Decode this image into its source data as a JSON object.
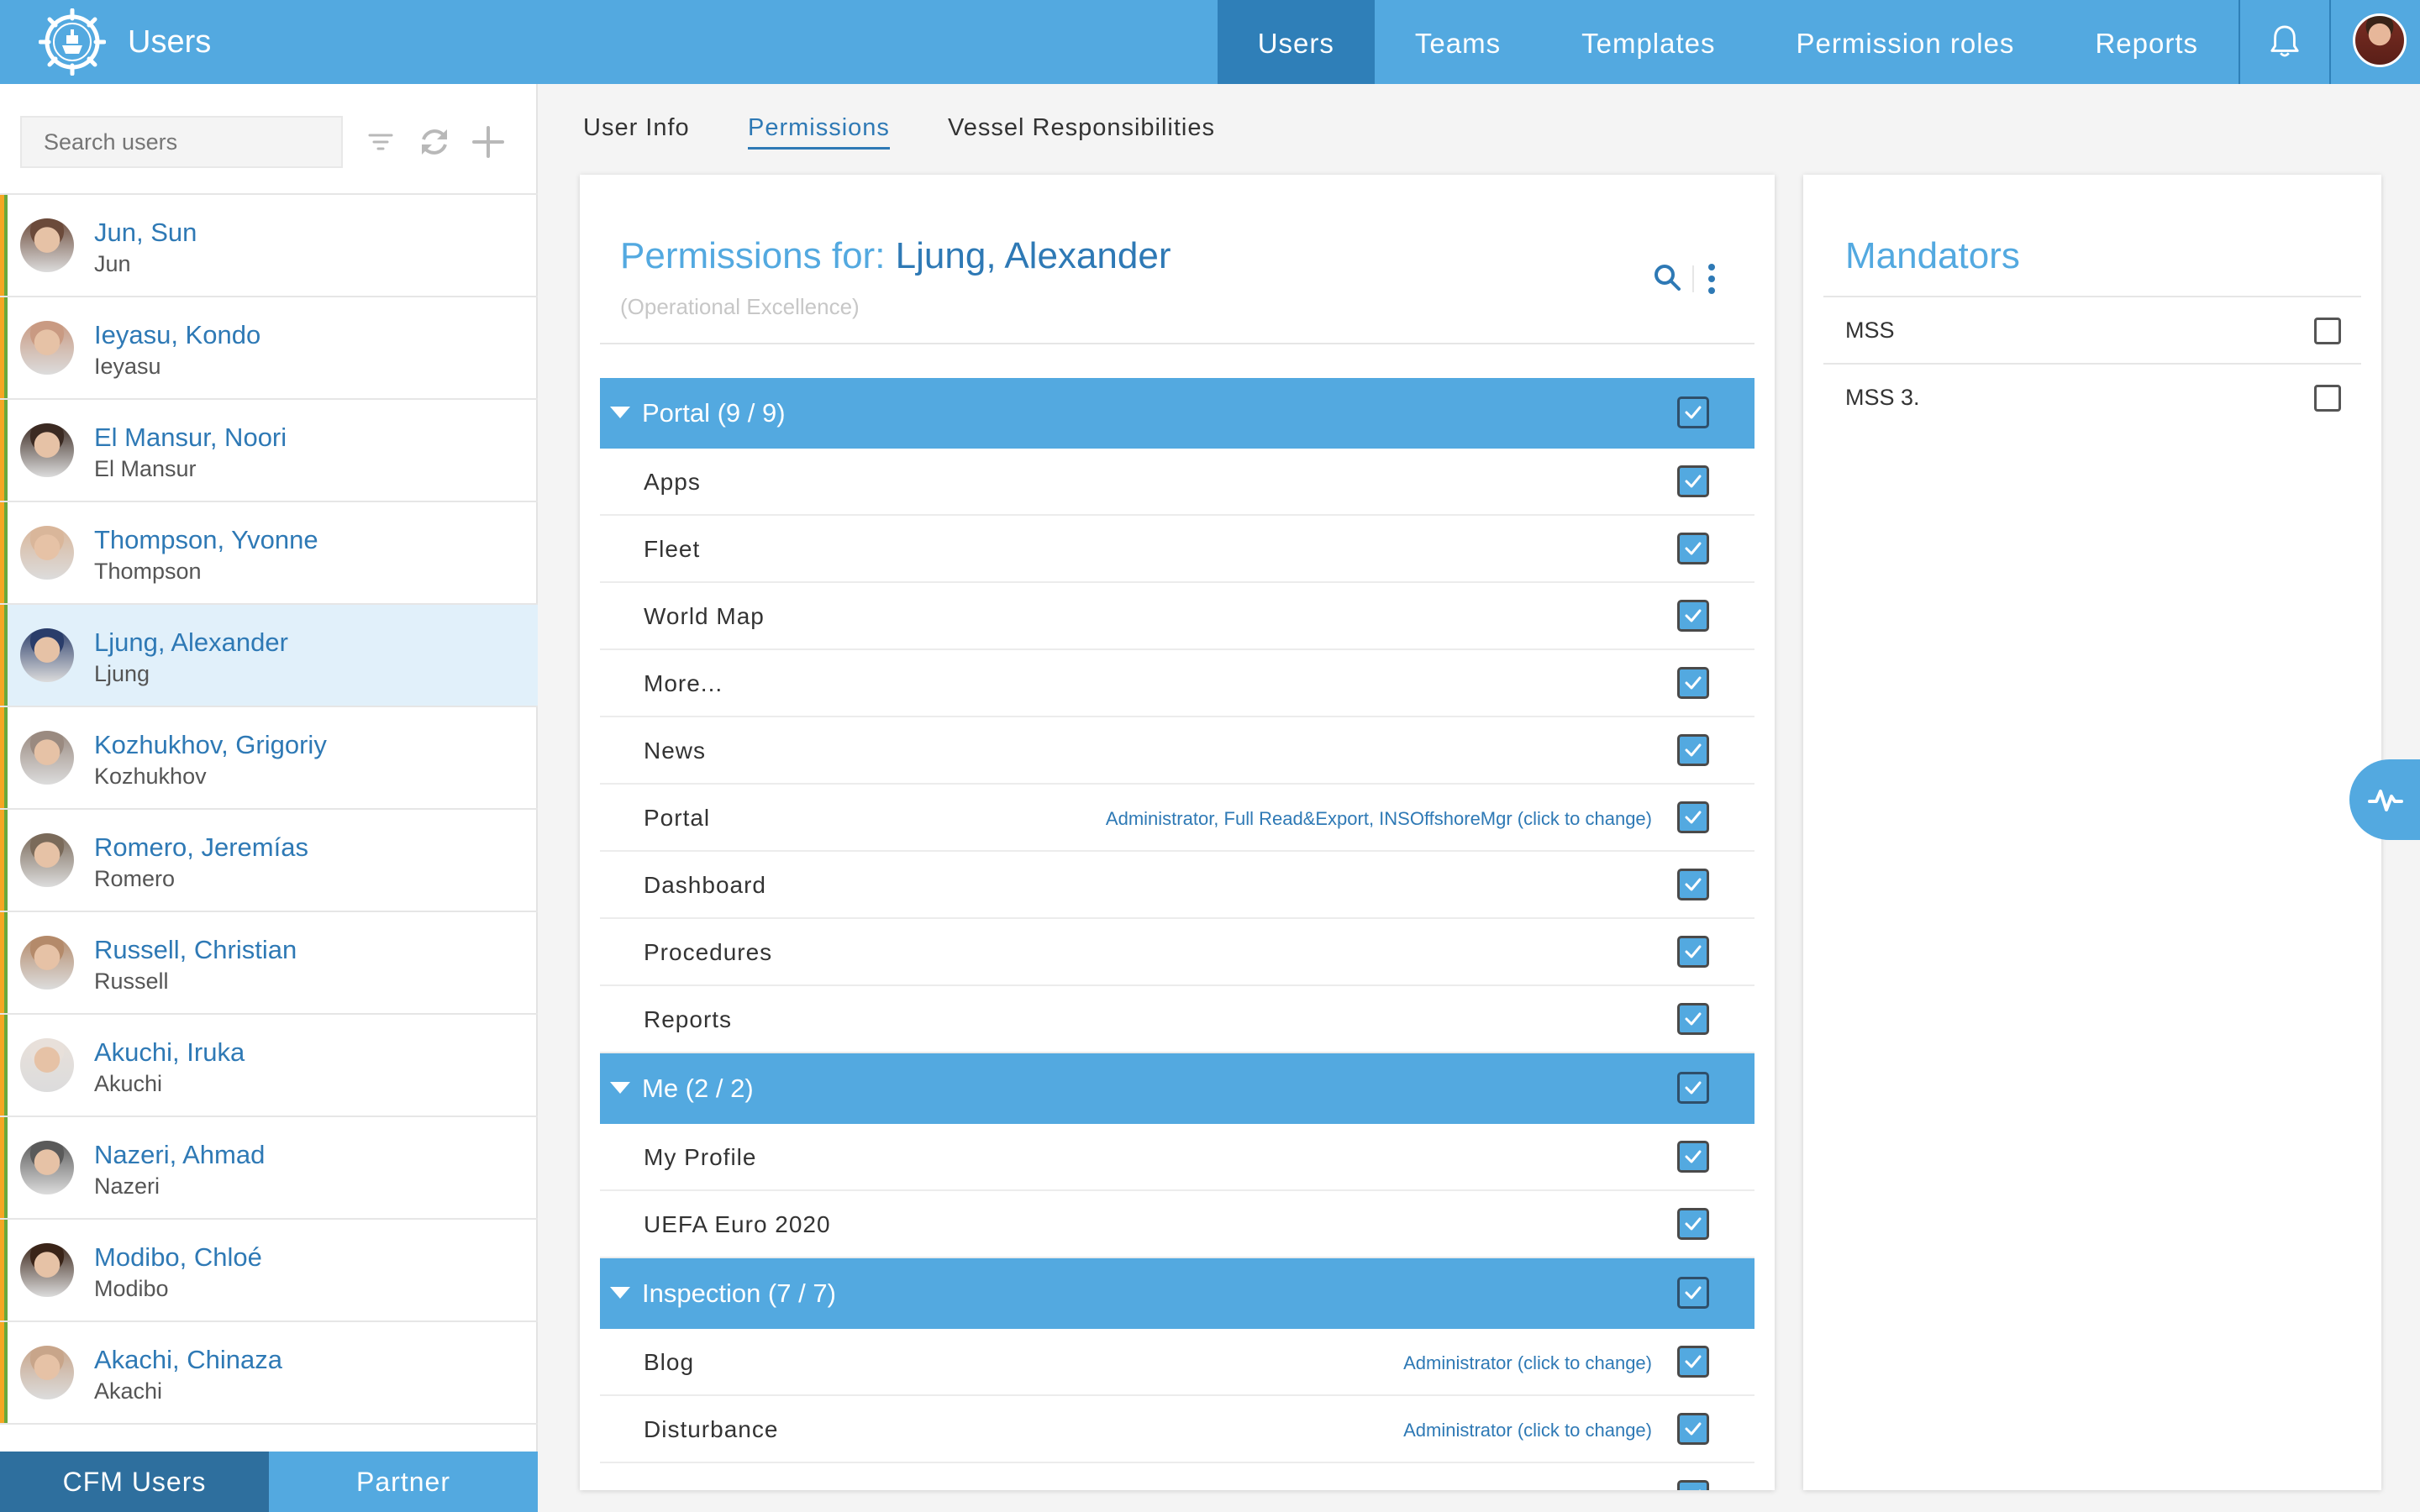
{
  "app": {
    "title": "Users"
  },
  "topnav": [
    {
      "label": "Users",
      "active": true
    },
    {
      "label": "Teams",
      "active": false
    },
    {
      "label": "Templates",
      "active": false
    },
    {
      "label": "Permission roles",
      "active": false
    },
    {
      "label": "Reports",
      "active": false
    }
  ],
  "colors": {
    "brand": "#53a9e0",
    "active_nav": "#2f7fb8",
    "link": "#2e79b5",
    "orange_stripe": "#f5a623",
    "green_stripe": "#6aa83a"
  },
  "sidebar": {
    "search_placeholder": "Search users",
    "tools": [
      "filter-icon",
      "refresh-icon",
      "add-icon"
    ],
    "users": [
      {
        "name": "Jun, Sun",
        "sub": "Jun",
        "avatar_color": "#6b4a3a"
      },
      {
        "name": "Ieyasu, Kondo",
        "sub": "Ieyasu",
        "avatar_color": "#c99a82"
      },
      {
        "name": "El Mansur, Noori",
        "sub": "El Mansur",
        "avatar_color": "#3b2a22"
      },
      {
        "name": "Thompson, Yvonne",
        "sub": "Thompson",
        "avatar_color": "#d9b69a"
      },
      {
        "name": "Ljung, Alexander",
        "sub": "Ljung",
        "avatar_color": "#2a3d6a",
        "selected": true
      },
      {
        "name": "Kozhukhov, Grigoriy",
        "sub": "Kozhukhov",
        "avatar_color": "#9a8a80"
      },
      {
        "name": "Romero, Jeremías",
        "sub": "Romero",
        "avatar_color": "#7a6a5a"
      },
      {
        "name": "Russell, Christian",
        "sub": "Russell",
        "avatar_color": "#b48a6a"
      },
      {
        "name": "Akuchi, Iruka",
        "sub": "Akuchi",
        "avatar_color": "#e8e0da"
      },
      {
        "name": "Nazeri, Ahmad",
        "sub": "Nazeri",
        "avatar_color": "#5a5a5a"
      },
      {
        "name": "Modibo, Chloé",
        "sub": "Modibo",
        "avatar_color": "#3a2418"
      },
      {
        "name": "Akachi, Chinaza",
        "sub": "Akachi",
        "avatar_color": "#c8a58a"
      }
    ],
    "bottom_tabs": [
      {
        "label": "CFM Users",
        "active": true
      },
      {
        "label": "Partner",
        "active": false
      }
    ]
  },
  "subtabs": [
    {
      "label": "User Info",
      "active": false
    },
    {
      "label": "Permissions",
      "active": true
    },
    {
      "label": "Vessel Responsibilities",
      "active": false
    }
  ],
  "permissions": {
    "title_prefix": "Permissions for:",
    "user_name": "Ljung, Alexander",
    "subtitle": "(Operational Excellence)",
    "groups": [
      {
        "label": "Portal (9 / 9)",
        "checked": true,
        "items": [
          {
            "label": "Apps",
            "checked": true
          },
          {
            "label": "Fleet",
            "checked": true
          },
          {
            "label": "World Map",
            "checked": true
          },
          {
            "label": "More...",
            "checked": true
          },
          {
            "label": "News",
            "checked": true
          },
          {
            "label": "Portal",
            "checked": true,
            "link": "Administrator, Full Read&Export, INSOffshoreMgr (click to change)"
          },
          {
            "label": "Dashboard",
            "checked": true
          },
          {
            "label": "Procedures",
            "checked": true
          },
          {
            "label": "Reports",
            "checked": true
          }
        ]
      },
      {
        "label": "Me (2 / 2)",
        "checked": true,
        "items": [
          {
            "label": "My Profile",
            "checked": true
          },
          {
            "label": "UEFA Euro 2020",
            "checked": true
          }
        ]
      },
      {
        "label": "Inspection (7 / 7)",
        "checked": true,
        "items": [
          {
            "label": "Blog",
            "checked": true,
            "link": "Administrator (click to change)"
          },
          {
            "label": "Disturbance",
            "checked": true,
            "link": "Administrator (click to change)"
          },
          {
            "label": "",
            "checked": true
          }
        ]
      }
    ]
  },
  "mandators": {
    "title": "Mandators",
    "items": [
      {
        "label": "MSS",
        "checked": false
      },
      {
        "label": "MSS 3.",
        "checked": false
      }
    ]
  }
}
